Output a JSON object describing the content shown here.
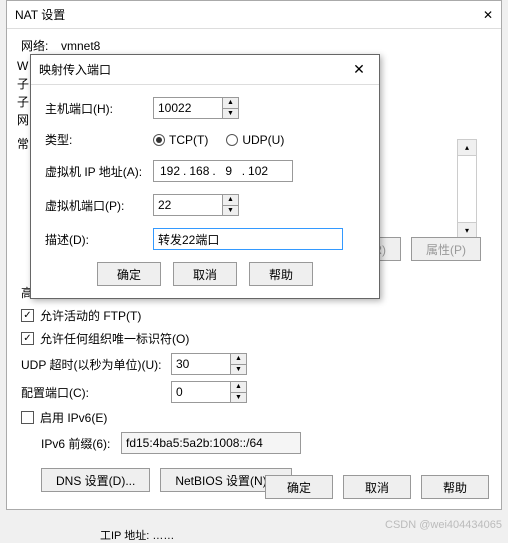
{
  "main": {
    "title": "NAT 设置",
    "close_glyph": "✕",
    "network_label": "网络:",
    "network_value": "vmnet8",
    "side_chars": [
      "W",
      "子",
      "子",
      "网",
      "常"
    ]
  },
  "right_buttons": {
    "remove": "除(R)",
    "properties": "属性(P)"
  },
  "advanced": {
    "title": "高级",
    "allow_ftp": "允许活动的 FTP(T)",
    "allow_oui": "允许任何组织唯一标识符(O)",
    "udp_timeout_label": "UDP 超时(以秒为单位)(U):",
    "udp_timeout_value": "30",
    "config_port_label": "配置端口(C):",
    "config_port_value": "0",
    "enable_ipv6": "启用 IPv6(E)",
    "ipv6_prefix_label": "IPv6 前缀(6):",
    "ipv6_prefix_value": "fd15:4ba5:5a2b:1008::/64",
    "dns_btn": "DNS 设置(D)...",
    "netbios_btn": "NetBIOS 设置(N)..."
  },
  "footer": {
    "ok": "确定",
    "cancel": "取消",
    "help": "帮助"
  },
  "dialog": {
    "title": "映射传入端口",
    "host_port_label": "主机端口(H):",
    "host_port_value": "10022",
    "type_label": "类型:",
    "tcp_label": "TCP(T)",
    "udp_label": "UDP(U)",
    "vm_ip_label": "虚拟机 IP 地址(A):",
    "ip": {
      "a": "192",
      "b": "168",
      "c": "9",
      "d": "102"
    },
    "vm_port_label": "虚拟机端口(P):",
    "vm_port_value": "22",
    "desc_label": "描述(D):",
    "desc_value": "转发22端口",
    "ok": "确定",
    "cancel": "取消",
    "help": "帮助"
  },
  "watermark": "CSDN @wei404434065",
  "truncated": "工IP 地址: ……"
}
